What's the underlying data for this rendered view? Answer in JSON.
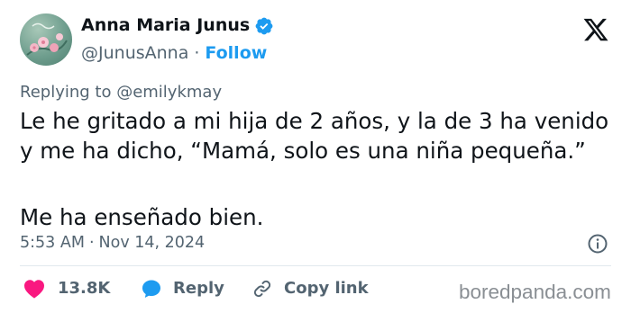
{
  "author": {
    "display_name": "Anna Maria Junus",
    "handle": "@JunusAnna",
    "separator": "·",
    "follow_label": "Follow",
    "verified": true,
    "verified_color": "#1d9bf0"
  },
  "reply_context": "Replying to @emilykmay",
  "tweet": {
    "lines": [
      "Le he gritado a mi hija de 2 años, y la de 3 ha venido",
      "y me ha dicho, “Mamá, solo es una niña pequeña.”",
      "Me ha enseñado bien."
    ]
  },
  "meta": {
    "time": "5:53 AM",
    "separator": "·",
    "date": "Nov 14, 2024"
  },
  "actions": {
    "likes_count": "13.8K",
    "reply_label": "Reply",
    "copy_link_label": "Copy link"
  },
  "watermark": "boredpanda.com",
  "colors": {
    "text": "#0f1419",
    "secondary": "#536471",
    "accent": "#1d9bf0",
    "like": "#f91880",
    "divider": "#e1e8ed"
  },
  "icons": {
    "avatar": "avatar-image",
    "verified": "verified-badge-icon",
    "brand": "x-logo-icon",
    "info": "info-icon",
    "like": "heart-icon",
    "reply": "speech-bubble-icon",
    "copy_link": "link-icon"
  }
}
